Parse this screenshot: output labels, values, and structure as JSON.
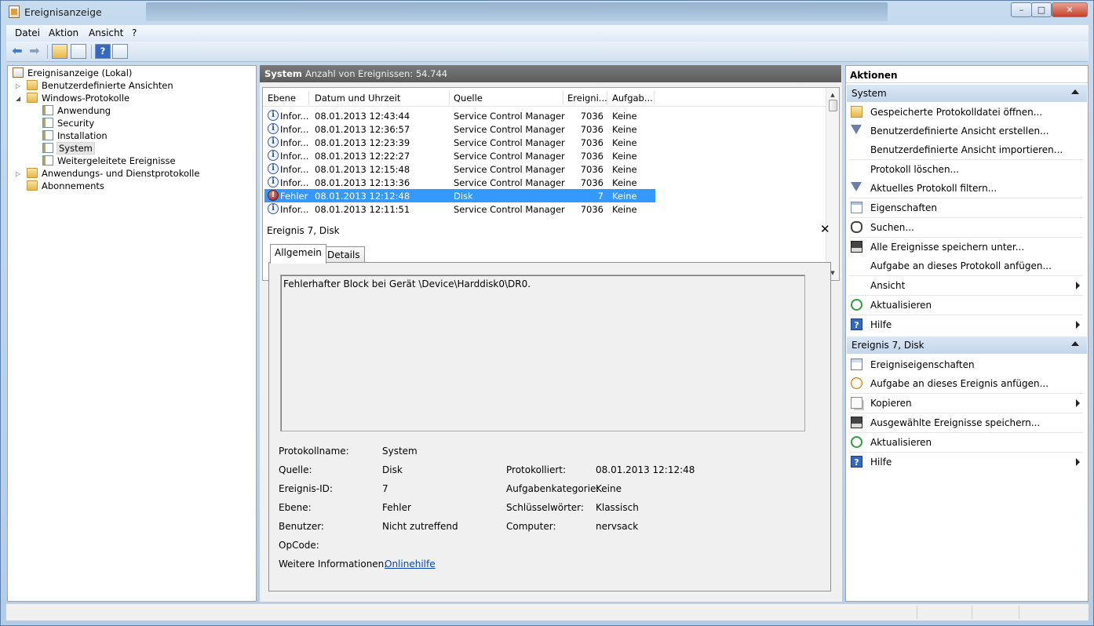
{
  "window": {
    "title": "Ereignisanzeige",
    "controls": {
      "minimize": "–",
      "maximize": "□",
      "close": "✕"
    }
  },
  "menu": [
    "Datei",
    "Aktion",
    "Ansicht",
    "?"
  ],
  "toolbar": {
    "icons": [
      "back-arrow-icon",
      "forward-arrow-icon",
      "up-folder-icon",
      "show-hide-console-tree-icon",
      "help-icon",
      "show-hide-action-pane-icon"
    ]
  },
  "tree": {
    "root": "Ereignisanzeige (Lokal)",
    "items": [
      {
        "label": "Benutzerdefinierte Ansichten"
      },
      {
        "label": "Windows-Protokolle"
      },
      {
        "label": "Anwendung"
      },
      {
        "label": "Security"
      },
      {
        "label": "Installation"
      },
      {
        "label": "System"
      },
      {
        "label": "Weitergeleitete Ereignisse"
      },
      {
        "label": "Anwendungs- und Dienstprotokolle"
      },
      {
        "label": "Abonnements"
      }
    ],
    "selected": "System"
  },
  "center": {
    "log_name": "System",
    "event_count": "Anzahl von Ereignissen: 54.744",
    "columns": [
      "Ebene",
      "Datum und Uhrzeit",
      "Quelle",
      "Ereigni...",
      "Aufgab..."
    ],
    "rows": [
      {
        "level": "Infor...",
        "datetime": "08.01.2013 12:43:44",
        "source": "Service Control Manager",
        "id": "7036",
        "task": "Keine"
      },
      {
        "level": "Infor...",
        "datetime": "08.01.2013 12:36:57",
        "source": "Service Control Manager",
        "id": "7036",
        "task": "Keine"
      },
      {
        "level": "Infor...",
        "datetime": "08.01.2013 12:23:39",
        "source": "Service Control Manager",
        "id": "7036",
        "task": "Keine"
      },
      {
        "level": "Infor...",
        "datetime": "08.01.2013 12:22:27",
        "source": "Service Control Manager",
        "id": "7036",
        "task": "Keine"
      },
      {
        "level": "Infor...",
        "datetime": "08.01.2013 12:15:48",
        "source": "Service Control Manager",
        "id": "7036",
        "task": "Keine"
      },
      {
        "level": "Infor...",
        "datetime": "08.01.2013 12:13:36",
        "source": "Service Control Manager",
        "id": "7036",
        "task": "Keine"
      },
      {
        "level": "Fehler",
        "datetime": "08.01.2013 12:12:48",
        "source": "Disk",
        "id": "7",
        "task": "Keine"
      },
      {
        "level": "Infor...",
        "datetime": "08.01.2013 12:11:51",
        "source": "Service Control Manager",
        "id": "7036",
        "task": "Keine"
      }
    ],
    "selected_row": 6
  },
  "detail": {
    "title": "Ereignis 7, Disk",
    "close": "✕",
    "tabs": [
      "Allgemein",
      "Details"
    ],
    "message": "Fehlerhafter Block bei Gerät \\Device\\Harddisk0\\DR0.",
    "props": {
      "protokollname_label": "Protokollname:",
      "protokollname": "System",
      "quelle_label": "Quelle:",
      "quelle": "Disk",
      "protokolliert_label": "Protokolliert:",
      "protokolliert": "08.01.2013 12:12:48",
      "ereignis_id_label": "Ereignis-ID:",
      "ereignis_id": "7",
      "aufgabenkategorie_label": "Aufgabenkategorie:",
      "aufgabenkategorie": "Keine",
      "ebene_label": "Ebene:",
      "ebene": "Fehler",
      "schluesselwoerter_label": "Schlüsselwörter:",
      "schluesselwoerter": "Klassisch",
      "benutzer_label": "Benutzer:",
      "benutzer": "Nicht zutreffend",
      "computer_label": "Computer:",
      "computer": "nervsack",
      "opcode_label": "OpCode:",
      "weitere_label": "Weitere Informationen:",
      "weitere_link": "Onlinehilfe"
    }
  },
  "actions": {
    "header": "Aktionen",
    "section1": "System",
    "section1_items": [
      {
        "label": "Gespeicherte Protokolldatei öffnen...",
        "icon": "folder-open-icon"
      },
      {
        "label": "Benutzerdefinierte Ansicht erstellen...",
        "icon": "filter-icon"
      },
      {
        "label": "Benutzerdefinierte Ansicht importieren...",
        "icon": ""
      },
      {
        "label": "Protokoll löschen...",
        "icon": ""
      },
      {
        "label": "Aktuelles Protokoll filtern...",
        "icon": "filter-icon"
      },
      {
        "label": "Eigenschaften",
        "icon": "properties-icon"
      },
      {
        "label": "Suchen...",
        "icon": "find-icon"
      },
      {
        "label": "Alle Ereignisse speichern unter...",
        "icon": "save-icon"
      },
      {
        "label": "Aufgabe an dieses Protokoll anfügen...",
        "icon": ""
      },
      {
        "label": "Ansicht",
        "icon": ""
      },
      {
        "label": "Aktualisieren",
        "icon": "refresh-icon"
      },
      {
        "label": "Hilfe",
        "icon": "help-icon"
      }
    ],
    "section2": "Ereignis 7, Disk",
    "section2_items": [
      {
        "label": "Ereigniseigenschaften",
        "icon": "event-properties-icon"
      },
      {
        "label": "Aufgabe an dieses Ereignis anfügen...",
        "icon": "task-icon"
      },
      {
        "label": "Kopieren",
        "icon": "copy-icon"
      },
      {
        "label": "Ausgewählte Ereignisse speichern...",
        "icon": "save-icon"
      },
      {
        "label": "Aktualisieren",
        "icon": "refresh-icon"
      },
      {
        "label": "Hilfe",
        "icon": "help-icon"
      }
    ]
  },
  "colors": {
    "selection": "#3399ff",
    "section_header": "#c3d6ec",
    "link": "#0645ad"
  }
}
